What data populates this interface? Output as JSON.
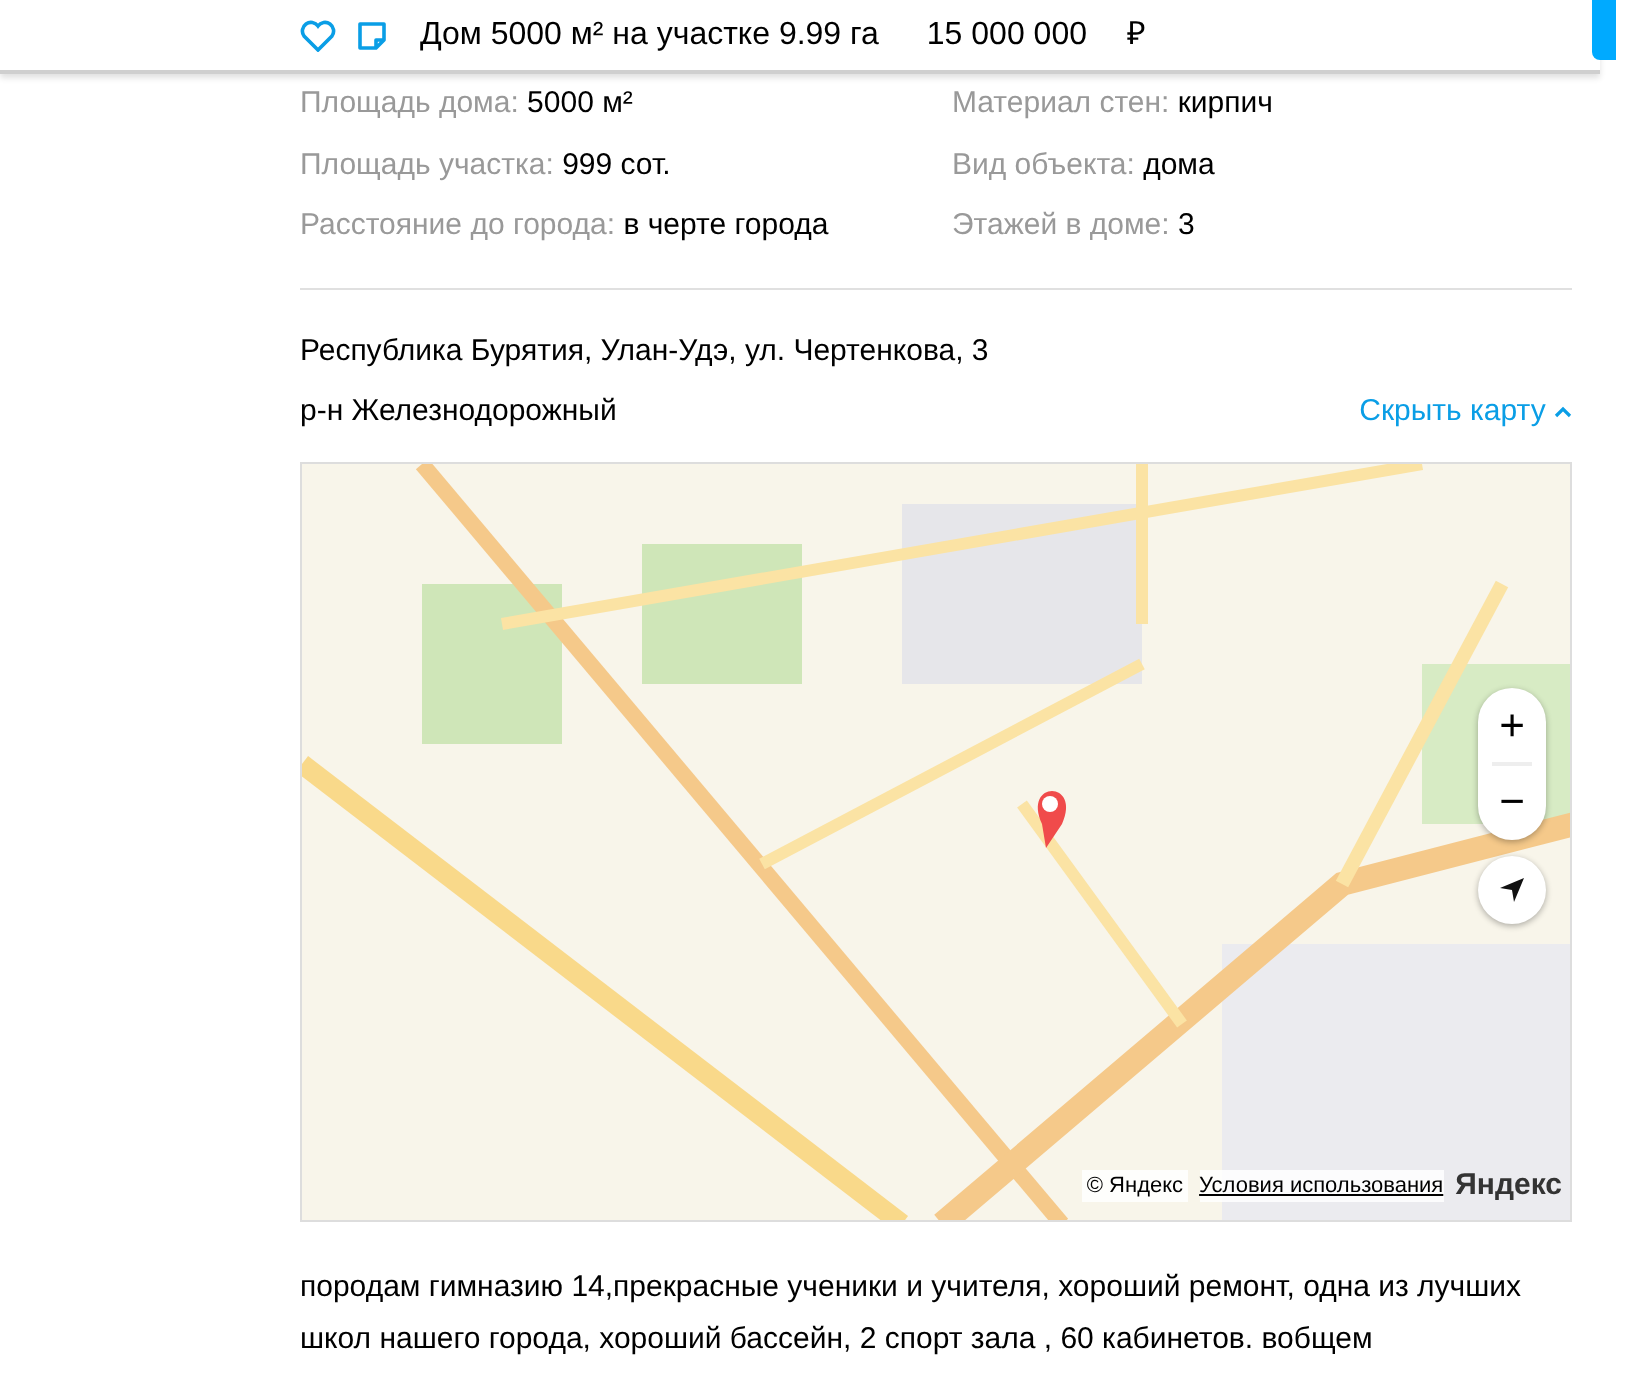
{
  "header": {
    "title": "Дом 5000 м² на участке 9.99 га",
    "price": "15 000 000",
    "currency": "₽",
    "favorite": false
  },
  "params": [
    {
      "label": "Площадь дома:",
      "value": "5000 м²"
    },
    {
      "label": "Материал стен:",
      "value": "кирпич"
    },
    {
      "label": "Площадь участка:",
      "value": "999 сот."
    },
    {
      "label": "Вид объекта:",
      "value": "дома"
    },
    {
      "label": "Расстояние до города:",
      "value": "в черте города"
    },
    {
      "label": "Этажей в доме:",
      "value": "3"
    }
  ],
  "address": {
    "line": "Республика Бурятия, Улан-Удэ, ул. Чертенкова, 3",
    "district": "р-н Железнодорожный",
    "toggle": "Скрыть карту"
  },
  "map": {
    "zoom_in": "+",
    "zoom_out": "−",
    "copyright": "© Яндекс",
    "terms": "Условия использования",
    "logo": "Яндекс"
  },
  "description": "породам гимназию 14,прекрасные ученики и учителя, хороший ремонт, одна из лучших школ нашего города, хороший бассейн, 2 спорт зала , 60 кабинетов. вобщем"
}
